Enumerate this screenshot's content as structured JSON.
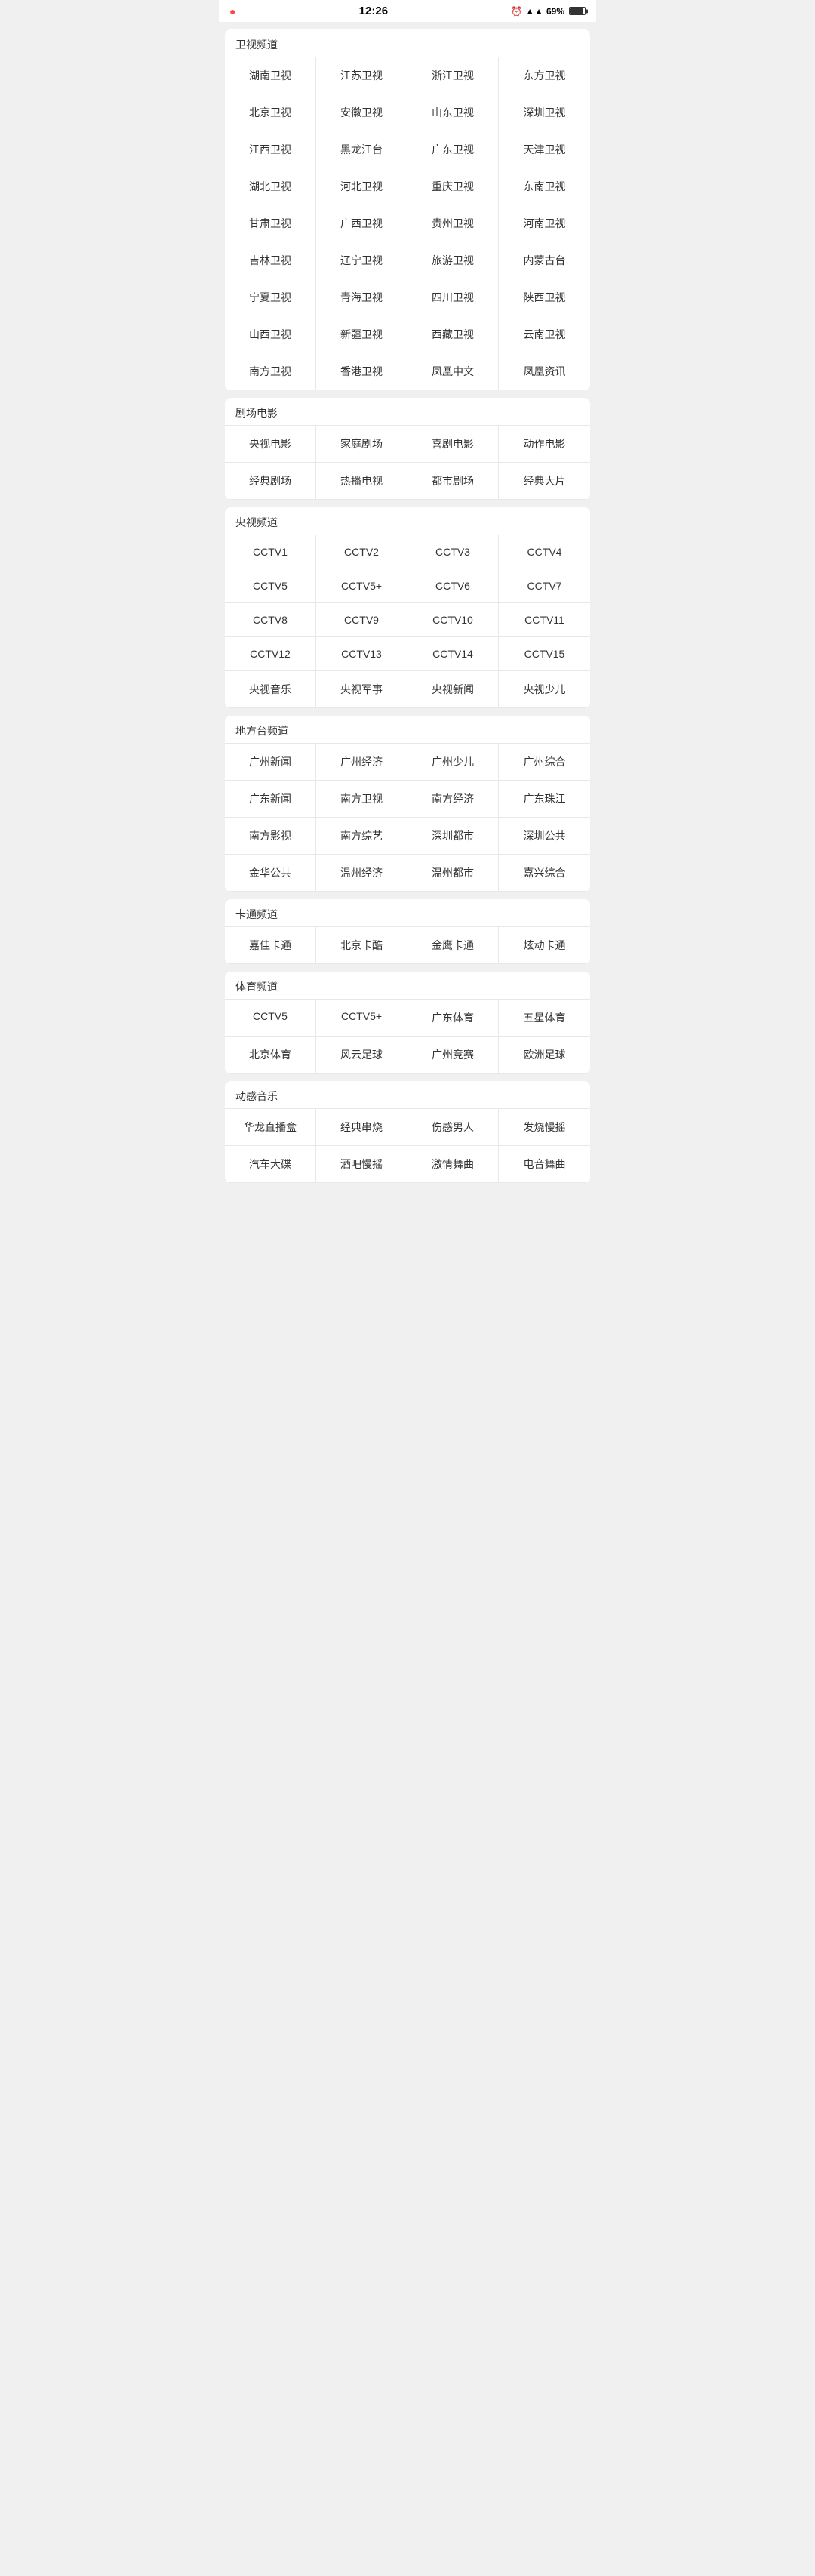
{
  "status_bar": {
    "notification": "1",
    "time": "12:26",
    "battery_level": "69%"
  },
  "sections": [
    {
      "id": "satellite",
      "title": "卫视频道",
      "items": [
        "湖南卫视",
        "江苏卫视",
        "浙江卫视",
        "东方卫视",
        "北京卫视",
        "安徽卫视",
        "山东卫视",
        "深圳卫视",
        "江西卫视",
        "黑龙江台",
        "广东卫视",
        "天津卫视",
        "湖北卫视",
        "河北卫视",
        "重庆卫视",
        "东南卫视",
        "甘肃卫视",
        "广西卫视",
        "贵州卫视",
        "河南卫视",
        "吉林卫视",
        "辽宁卫视",
        "旅游卫视",
        "内蒙古台",
        "宁夏卫视",
        "青海卫视",
        "四川卫视",
        "陕西卫视",
        "山西卫视",
        "新疆卫视",
        "西藏卫视",
        "云南卫视",
        "南方卫视",
        "香港卫视",
        "凤凰中文",
        "凤凰资讯"
      ]
    },
    {
      "id": "theater",
      "title": "剧场电影",
      "items": [
        "央视电影",
        "家庭剧场",
        "喜剧电影",
        "动作电影",
        "经典剧场",
        "热播电视",
        "都市剧场",
        "经典大片"
      ]
    },
    {
      "id": "cctv",
      "title": "央视频道",
      "items": [
        "CCTV1",
        "CCTV2",
        "CCTV3",
        "CCTV4",
        "CCTV5",
        "CCTV5+",
        "CCTV6",
        "CCTV7",
        "CCTV8",
        "CCTV9",
        "CCTV10",
        "CCTV11",
        "CCTV12",
        "CCTV13",
        "CCTV14",
        "CCTV15",
        "央视音乐",
        "央视军事",
        "央视新闻",
        "央视少儿"
      ]
    },
    {
      "id": "local",
      "title": "地方台频道",
      "items": [
        "广州新闻",
        "广州经济",
        "广州少儿",
        "广州综合",
        "广东新闻",
        "南方卫视",
        "南方经济",
        "广东珠江",
        "南方影视",
        "南方综艺",
        "深圳都市",
        "深圳公共",
        "金华公共",
        "温州经济",
        "温州都市",
        "嘉兴综合"
      ]
    },
    {
      "id": "cartoon",
      "title": "卡通频道",
      "items": [
        "嘉佳卡通",
        "北京卡酷",
        "金鹰卡通",
        "炫动卡通"
      ]
    },
    {
      "id": "sports",
      "title": "体育频道",
      "items": [
        "CCTV5",
        "CCTV5+",
        "广东体育",
        "五星体育",
        "北京体育",
        "风云足球",
        "广州竞赛",
        "欧洲足球"
      ]
    },
    {
      "id": "music",
      "title": "动感音乐",
      "items": [
        "华龙直播盒",
        "经典串烧",
        "伤感男人",
        "发烧慢摇",
        "汽车大碟",
        "酒吧慢摇",
        "激情舞曲",
        "电音舞曲"
      ]
    }
  ]
}
